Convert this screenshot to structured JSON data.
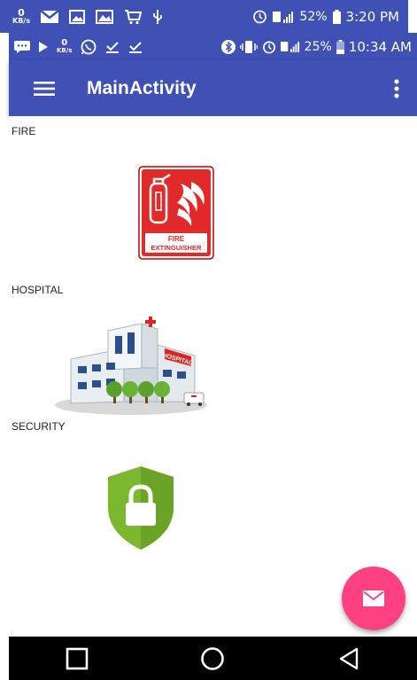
{
  "status_bar_top": {
    "netspeed_value": "0",
    "netspeed_unit": "KB/s",
    "battery_percent": "52%",
    "time": "3:20 PM"
  },
  "status_bar_inner": {
    "netspeed_value": "0",
    "netspeed_unit": "KB/s",
    "battery_percent": "25%",
    "time": "10:34 AM"
  },
  "app_bar": {
    "title": "MainActivity"
  },
  "sections": [
    {
      "label": "FIRE",
      "image": "fire-extinguisher-sign",
      "sign_text_1": "FIRE",
      "sign_text_2": "EXTINGUISHER"
    },
    {
      "label": "HOSPITAL",
      "image": "hospital-building",
      "building_sign": "HOSPITAL"
    },
    {
      "label": "SECURITY",
      "image": "security-shield-lock"
    }
  ],
  "colors": {
    "primary": "#3F51B5",
    "accent": "#FF4081",
    "fire_red": "#E32A2A",
    "shield_green": "#7CB82F"
  },
  "fab": {
    "icon": "email-icon"
  },
  "nav_bar": {
    "icons": [
      "square-recents-icon",
      "circle-home-icon",
      "triangle-back-icon"
    ]
  }
}
